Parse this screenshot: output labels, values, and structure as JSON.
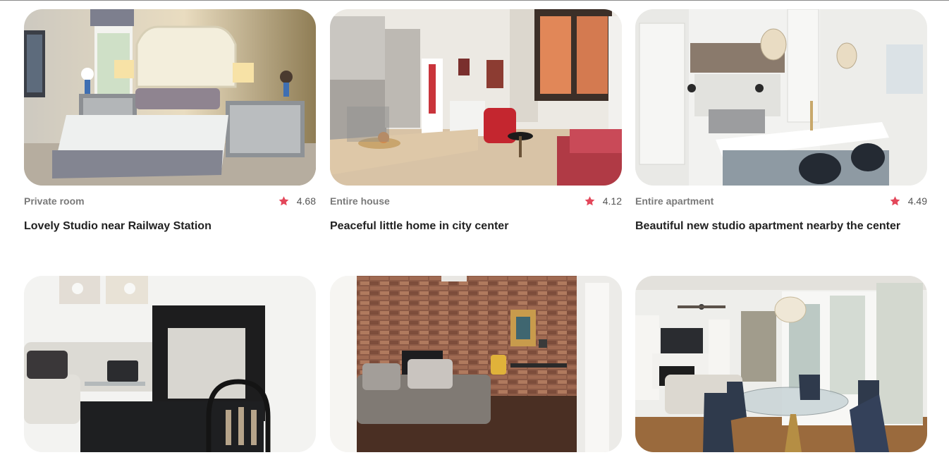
{
  "listings": [
    {
      "type": "Private room",
      "rating": "4.68",
      "title": "Lovely Studio near Railway Station",
      "image": "bedroom-photo"
    },
    {
      "type": "Entire house",
      "rating": "4.12",
      "title": "Peaceful little home in city center",
      "image": "living-dining-photo"
    },
    {
      "type": "Entire apartment",
      "rating": "4.49",
      "title": "Beautiful new studio apartment nearby the center",
      "image": "white-kitchen-photo"
    },
    {
      "type": "",
      "rating": "",
      "title": "",
      "image": "white-sofa-fireplace-photo"
    },
    {
      "type": "",
      "rating": "",
      "title": "",
      "image": "brick-wall-living-photo"
    },
    {
      "type": "",
      "rating": "",
      "title": "",
      "image": "dining-room-photo"
    }
  ],
  "colors": {
    "star": "#e3475a",
    "type_text": "#7a7a7a",
    "title_text": "#222222"
  },
  "icons": {
    "rating": "star-icon"
  }
}
